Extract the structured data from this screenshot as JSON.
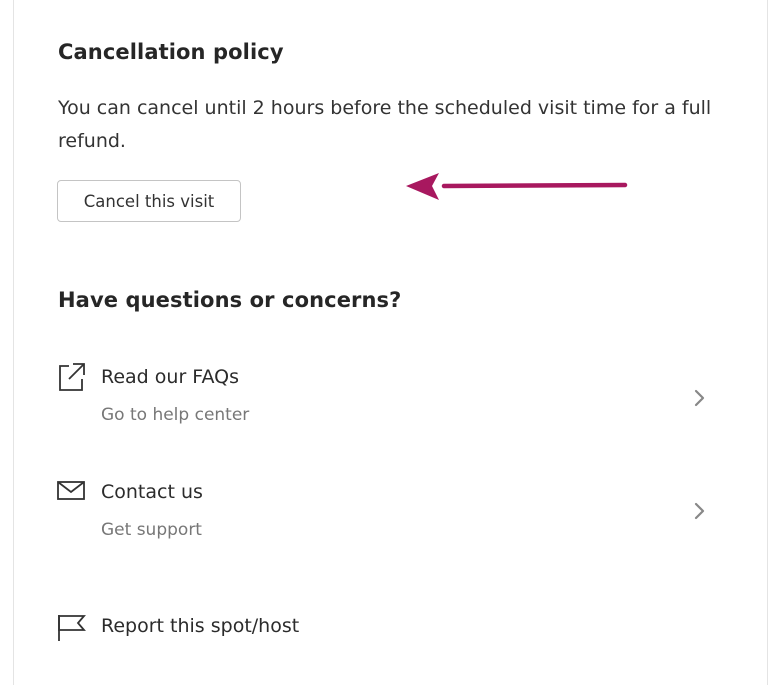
{
  "cancellation": {
    "title": "Cancellation policy",
    "text": "You can cancel until 2 hours before the scheduled visit time for a full refund.",
    "button_label": "Cancel this visit"
  },
  "questions": {
    "title": "Have questions or concerns?",
    "items": [
      {
        "label": "Read our FAQs",
        "sub": "Go to help center",
        "icon": "external-link-icon"
      },
      {
        "label": "Contact us",
        "sub": "Get support",
        "icon": "envelope-icon"
      },
      {
        "label": "Report this spot/host",
        "icon": "flag-icon"
      }
    ]
  },
  "colors": {
    "arrow": "#a8185f",
    "text": "#2e2e2e",
    "muted": "#777777",
    "border": "#c4c4c4"
  }
}
